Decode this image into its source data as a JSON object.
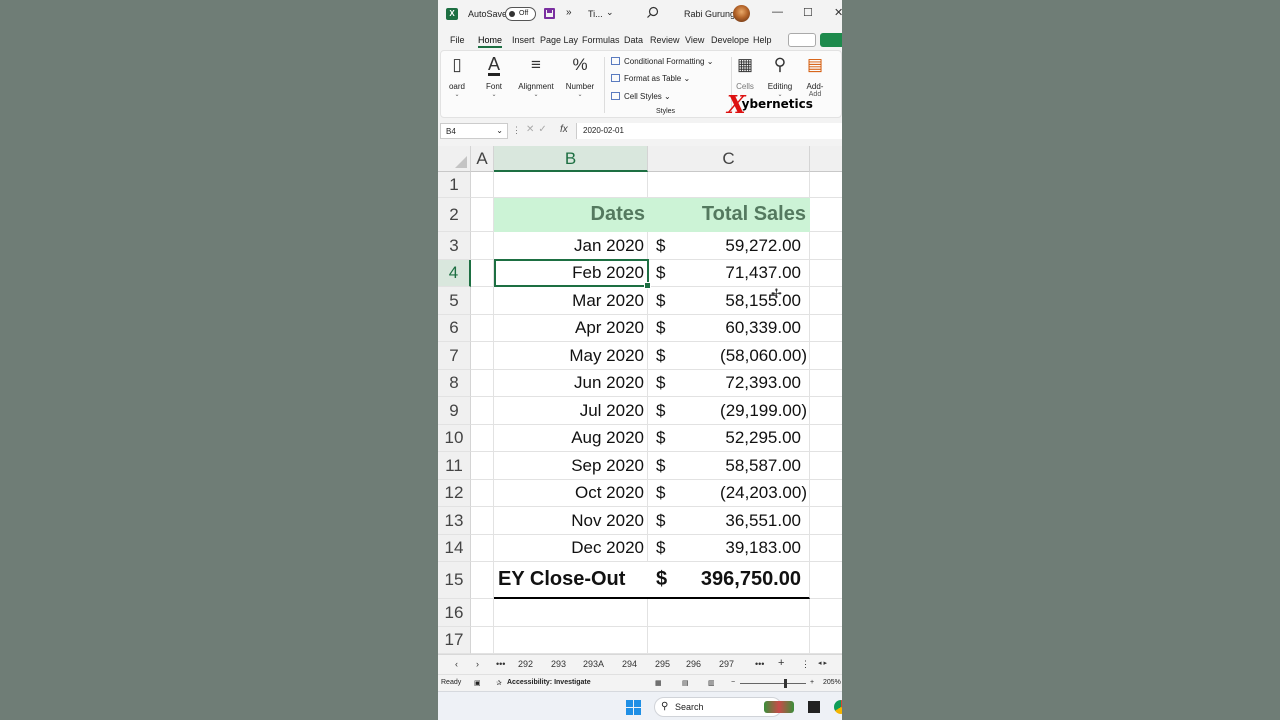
{
  "titlebar": {
    "autosave_label": "AutoSave",
    "autosave_state": "Off",
    "more": "»",
    "doc_title": "Ti...",
    "user": "Rabi Gurung",
    "min": "—",
    "max": "☐",
    "close": "✕"
  },
  "tabs": [
    "File",
    "Home",
    "Insert",
    "Page Lay",
    "Formulas",
    "Data",
    "Review",
    "View",
    "Develope",
    "Help"
  ],
  "ribbon": {
    "clipboard": "oard",
    "font": "Font",
    "alignment": "Alignment",
    "number": "Number",
    "conditional_formatting": "Conditional Formatting",
    "format_as_table": "Format as Table",
    "cell_styles": "Cell Styles",
    "styles_group": "Styles",
    "cells": "Cells",
    "editing": "Editing",
    "addins": "Add-",
    "addins_group": "Add"
  },
  "watermark": {
    "x": "X",
    "text": "ybernetics"
  },
  "formula_bar": {
    "name_box": "B4",
    "value": "2020-02-01"
  },
  "columns": [
    "A",
    "B",
    "C"
  ],
  "rows": [
    "1",
    "2",
    "3",
    "4",
    "5",
    "6",
    "7",
    "8",
    "9",
    "10",
    "11",
    "12",
    "13",
    "14",
    "15",
    "16",
    "17"
  ],
  "sheet": {
    "header": {
      "dates": "Dates",
      "sales": "Total Sales"
    },
    "currency": "$",
    "data": [
      {
        "date": "Jan 2020",
        "amount": "59,272.00"
      },
      {
        "date": "Feb 2020",
        "amount": "71,437.00"
      },
      {
        "date": "Mar 2020",
        "amount": "58,155.00"
      },
      {
        "date": "Apr 2020",
        "amount": "60,339.00"
      },
      {
        "date": "May 2020",
        "amount": "(58,060.00)"
      },
      {
        "date": "Jun 2020",
        "amount": "72,393.00"
      },
      {
        "date": "Jul 2020",
        "amount": "(29,199.00)"
      },
      {
        "date": "Aug 2020",
        "amount": "52,295.00"
      },
      {
        "date": "Sep 2020",
        "amount": "58,587.00"
      },
      {
        "date": "Oct 2020",
        "amount": "(24,203.00)"
      },
      {
        "date": "Nov 2020",
        "amount": "36,551.00"
      },
      {
        "date": "Dec 2020",
        "amount": "39,183.00"
      }
    ],
    "total": {
      "label": "EY Close-Out",
      "amount": "396,750.00"
    }
  },
  "sheet_tabs": [
    "292",
    "293",
    "293A",
    "294",
    "295",
    "296",
    "297"
  ],
  "status": {
    "ready": "Ready",
    "accessibility": "Accessibility: Investigate",
    "zoom": "205%"
  },
  "taskbar": {
    "search": "Search"
  },
  "colors": {
    "excel_green": "#1d6f42",
    "header_fill": "#ccf3d6",
    "header_text": "#54795f"
  }
}
